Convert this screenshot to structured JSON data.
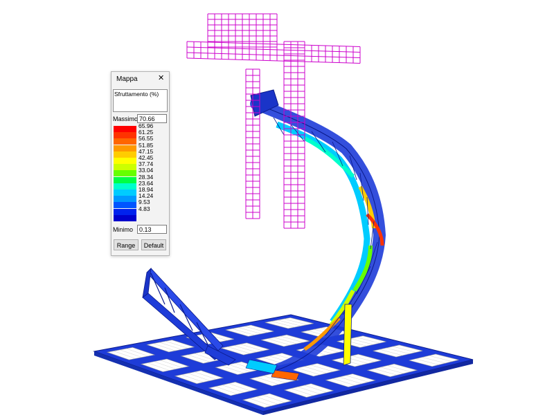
{
  "panel": {
    "title": "Mappa",
    "close_icon": "close-icon",
    "quantity_label": "Sfruttamento (%)",
    "max_label": "Massimo",
    "max_value": "70.66",
    "min_label": "Minimo",
    "min_value": "0.13",
    "range_button": "Range",
    "default_button": "Default"
  },
  "legend": [
    {
      "label": "65.96",
      "color": "#ff0000"
    },
    {
      "label": "61.25",
      "color": "#ff3300"
    },
    {
      "label": "56.55",
      "color": "#ff6600"
    },
    {
      "label": "51.85",
      "color": "#ff9900"
    },
    {
      "label": "47.15",
      "color": "#ffcc00"
    },
    {
      "label": "42.45",
      "color": "#ffff00"
    },
    {
      "label": "37.74",
      "color": "#ccff00"
    },
    {
      "label": "33.04",
      "color": "#66ff00"
    },
    {
      "label": "28.34",
      "color": "#00ff44"
    },
    {
      "label": "23.64",
      "color": "#00ffcc"
    },
    {
      "label": "18.94",
      "color": "#00ccff"
    },
    {
      "label": "14.24",
      "color": "#0099ff"
    },
    {
      "label": "9.53",
      "color": "#0055ff"
    },
    {
      "label": "4.83",
      "color": "#0022ee"
    },
    {
      "label": "",
      "color": "#0000cc"
    }
  ],
  "colors": {
    "mesh": "#cc00cc",
    "plate": "#1e3cd8",
    "grid_cell": "#ffffff"
  }
}
